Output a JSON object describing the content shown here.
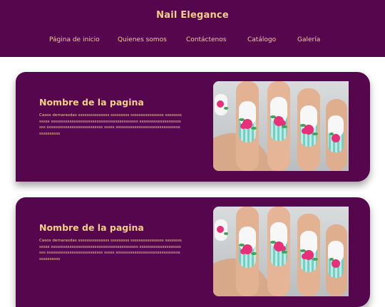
{
  "header": {
    "brand": "Nail Elegance",
    "nav": [
      {
        "label": "Página de inicio"
      },
      {
        "label": "Quienes somos"
      },
      {
        "label": "Contáctenos"
      },
      {
        "label": "Catálogo"
      },
      {
        "label": "Galería"
      }
    ]
  },
  "cards": [
    {
      "title": "Nombre de la pagina",
      "text": "Casos demarasdas sssssssssssssss sssssssss ssssssssssssssss sssssssssssss ssssssssssssssssssssssssssssssssssssssssss sssssssssssssssssssssss sssssssssssssssssssssssssss sssss sssssssssssssssssssssssssssssssssssssssss",
      "image": "nail-art-photo"
    },
    {
      "title": "Nombre de la pagina",
      "text": "Casos demarasdas sssssssssssssss sssssssss ssssssssssssssss sssssssssssss ssssssssssssssssssssssssssssssssssssssssss sssssssssssssssssssssss sssssssssssssssssssssssssss sssss sssssssssssssssssssssssssssssssssssssssss",
      "image": "nail-art-photo"
    }
  ],
  "colors": {
    "primary": "#56064d",
    "accent": "#f2d08a",
    "background": "#ffffff"
  }
}
